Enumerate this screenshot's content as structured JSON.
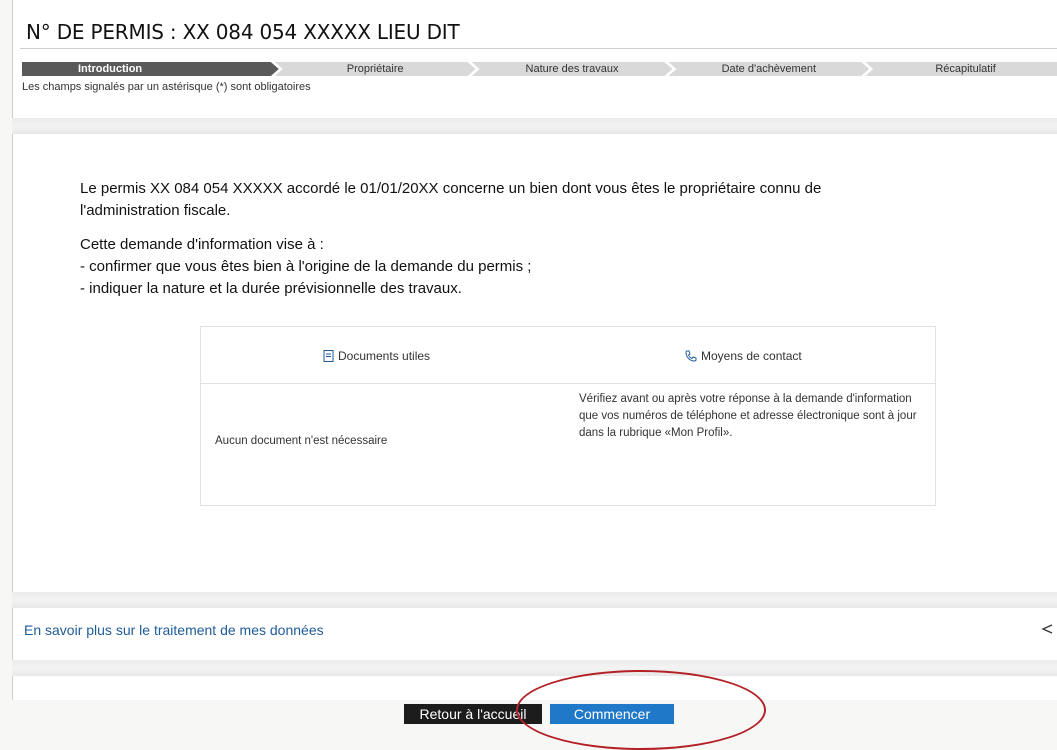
{
  "header": {
    "title": "N° DE PERMIS : XX 084 054  XXXXX LIEU DIT"
  },
  "steps": [
    {
      "label": "Introduction",
      "active": true
    },
    {
      "label": "Propriétaire",
      "active": false
    },
    {
      "label": "Nature des travaux",
      "active": false
    },
    {
      "label": "Date d'achèvement",
      "active": false
    },
    {
      "label": "Récapitulatif",
      "active": false
    }
  ],
  "required_note": "Les champs signalés par un astérisque (*) sont obligatoires",
  "intro": {
    "line1": "Le permis XX 084 054 XXXXX    accordé le 01/01/20XX concerne un bien dont vous êtes le propriétaire connu de",
    "line2": "l'administration fiscale.",
    "purpose_heading": "Cette demande d'information vise à :",
    "bullet1": "- confirmer que vous êtes bien à l'origine de la demande du permis ;",
    "bullet2": "- indiquer la nature et la durée prévisionnelle des travaux."
  },
  "info": {
    "documents_title": "Documents utiles",
    "documents_icon": "document-icon",
    "documents_body": "Aucun document n'est nécessaire",
    "contact_title": "Moyens de contact",
    "contact_icon": "phone-icon",
    "contact_body": "Vérifiez avant ou après votre réponse à la demande d'information que vos numéros de téléphone et adresse électronique sont à jour dans la rubrique «Mon Profil»."
  },
  "data_link": "En savoir plus sur le traitement de mes données",
  "buttons": {
    "back": "Retour à l'accueil",
    "start": "Commencer"
  },
  "colors": {
    "link": "#1f5c99",
    "primary_button": "#2078c8",
    "back_button": "#1c1c1c",
    "annotation_circle": "#b32025"
  }
}
